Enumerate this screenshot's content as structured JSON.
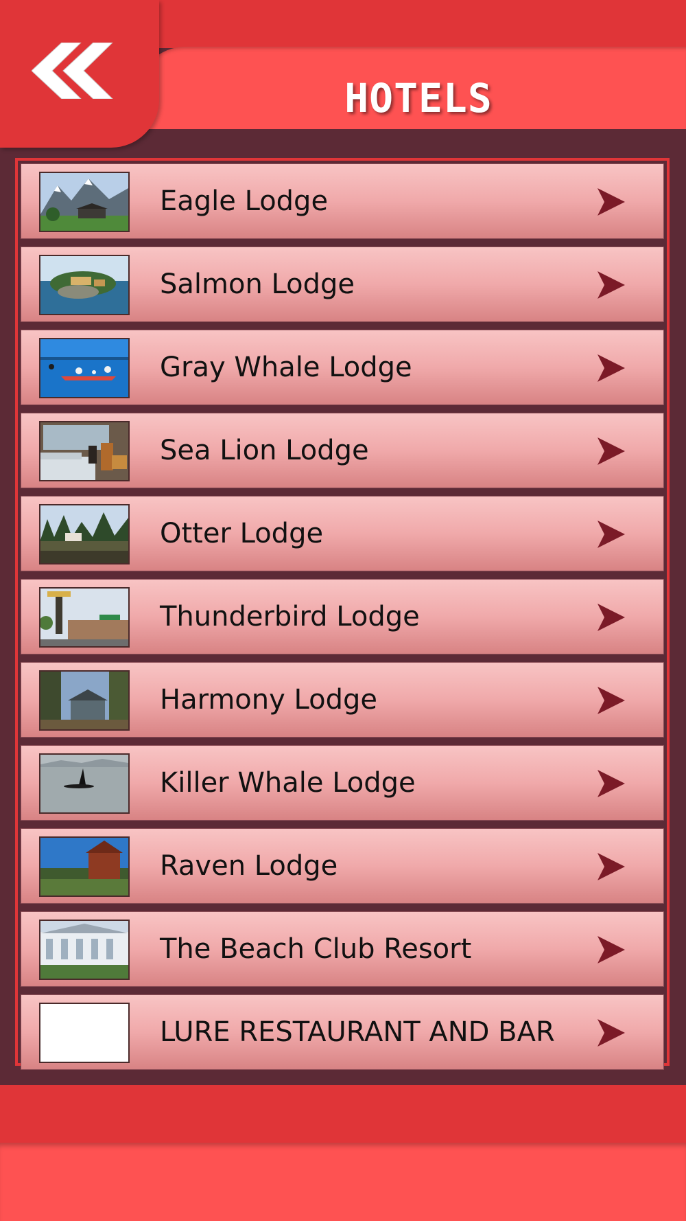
{
  "header": {
    "title": "HOTELS",
    "back_icon": "double-chevron-left-icon"
  },
  "colors": {
    "header_red": "#e03538",
    "header_band": "#fe5252",
    "background": "#5c2a36",
    "arrow": "#7b1a27"
  },
  "list": {
    "items": [
      {
        "label": "Eagle Lodge",
        "thumb": "mountain-lodge"
      },
      {
        "label": "Salmon Lodge",
        "thumb": "island-lodge"
      },
      {
        "label": "Gray Whale Lodge",
        "thumb": "kayak"
      },
      {
        "label": "Sea Lion Lodge",
        "thumb": "room-interior"
      },
      {
        "label": "Otter Lodge",
        "thumb": "waterfront"
      },
      {
        "label": "Thunderbird Lodge",
        "thumb": "town-street"
      },
      {
        "label": "Harmony Lodge",
        "thumb": "cabin-in-trees"
      },
      {
        "label": "Killer Whale Lodge",
        "thumb": "orca"
      },
      {
        "label": "Raven Lodge",
        "thumb": "wood-house"
      },
      {
        "label": "The Beach Club Resort",
        "thumb": "resort-building"
      },
      {
        "label": "LURE RESTAURANT AND BAR",
        "thumb": "blank"
      }
    ],
    "item_icon": "chevron-right-icon"
  }
}
